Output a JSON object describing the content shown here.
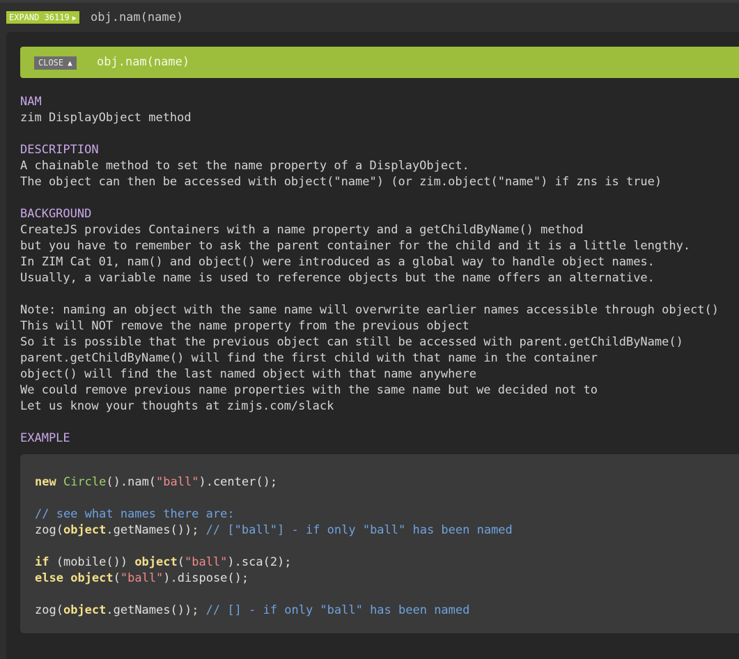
{
  "expand": {
    "button_label": "EXPAND 36119",
    "arrow": "▶",
    "title": "obj.nam(name)"
  },
  "card": {
    "close_label": "CLOSE",
    "close_arrow": "▲",
    "title": "obj.nam(name)"
  },
  "doc": {
    "nam_heading": "NAM",
    "nam_text": "zim DisplayObject method",
    "description_heading": "DESCRIPTION",
    "description_lines": [
      "A chainable method to set the name property of a DisplayObject.",
      "The object can then be accessed with object(\"name\") (or zim.object(\"name\") if zns is true)"
    ],
    "background_heading": "BACKGROUND",
    "background_lines": [
      "CreateJS provides Containers with a name property and a getChildByName() method",
      "but you have to remember to ask the parent container for the child and it is a little lengthy.",
      "In ZIM Cat 01, nam() and object() were introduced as a global way to handle object names.",
      "Usually, a variable name is used to reference objects but the name offers an alternative."
    ],
    "note_lines": [
      "Note: naming an object with the same name will overwrite earlier names accessible through object()",
      "This will NOT remove the name property from the previous object",
      "So it is possible that the previous object can still be accessed with parent.getChildByName()",
      "parent.getChildByName() will find the first child with that name in the container",
      "object() will find the last named object with that name anywhere",
      "We could remove previous name properties with the same name but we decided not to",
      "Let us know your thoughts at zimjs.com/slack"
    ],
    "example_heading": "EXAMPLE"
  },
  "code": {
    "l1": {
      "kw": "new",
      "cls": "Circle",
      "a": "().nam(",
      "s": "\"ball\"",
      "b": ").center();"
    },
    "l2": {
      "c": "// see what names there are:"
    },
    "l3": {
      "a": "zog(",
      "kw": "object",
      "b": ".getNames()); ",
      "c": "// [\"ball\"] - if only \"ball\" has been named"
    },
    "l4": {
      "kw1": "if",
      "a": " (mobile()) ",
      "kw2": "object",
      "b": "(",
      "s": "\"ball\"",
      "c": ").sca(2);"
    },
    "l5": {
      "kw1": "else",
      "kw2": "object",
      "b": "(",
      "s": "\"ball\"",
      "c": ").dispose();"
    },
    "l6": {
      "a": "zog(",
      "kw": "object",
      "b": ".getNames()); ",
      "c": "// [] - if only \"ball\" has been named"
    }
  },
  "colors": {
    "accent_green": "#9cbe3c",
    "heading_purple": "#c9a8e8",
    "keyword_yellow": "#f3e08a",
    "string_red": "#f08a8a",
    "comment_blue": "#6fa3e0",
    "class_green": "#9fd36a"
  }
}
